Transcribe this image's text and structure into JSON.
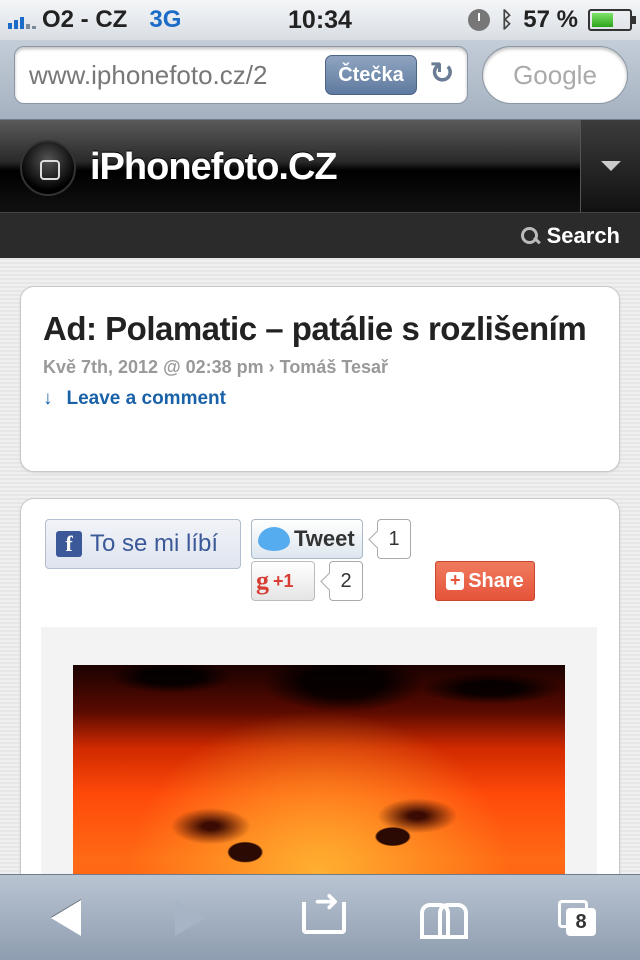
{
  "status_bar": {
    "carrier": "O2 - CZ",
    "network": "3G",
    "time": "10:34",
    "battery": "57 %",
    "battery_level": 0.57
  },
  "url_bar": {
    "url": "www.iphonefoto.cz/2",
    "reader_label": "Čtečka",
    "search_placeholder": "Google"
  },
  "site": {
    "title": "iPhonefoto.CZ",
    "search_label": "Search"
  },
  "post": {
    "title": "Ad: Polamatic – patálie s rozlišením",
    "meta": "Kvě 7th, 2012 @ 02:38 pm › Tomáš Tesař",
    "comment_arrow": "↓",
    "comment_link": "Leave a comment"
  },
  "social": {
    "fb_label": "To se mi líbí",
    "tweet_label": "Tweet",
    "tweet_count": "1",
    "gplus_label": "+1",
    "gplus_count": "2",
    "share_label": "Share"
  },
  "toolbar": {
    "tabs_count": "8"
  },
  "icons": [
    "signal-icon",
    "clock-icon",
    "bluetooth-icon",
    "battery-icon",
    "reload-icon",
    "logo-icon",
    "chevron-down-icon",
    "search-icon",
    "facebook-icon",
    "twitter-icon",
    "google-plus-icon",
    "plus-icon",
    "back-icon",
    "forward-icon",
    "share-icon",
    "bookmarks-icon",
    "tabs-icon"
  ],
  "colors": {
    "accent_blue": "#1a62a8",
    "share_red": "#e5533a",
    "facebook_blue": "#3b5998",
    "header_black": "#000000"
  }
}
